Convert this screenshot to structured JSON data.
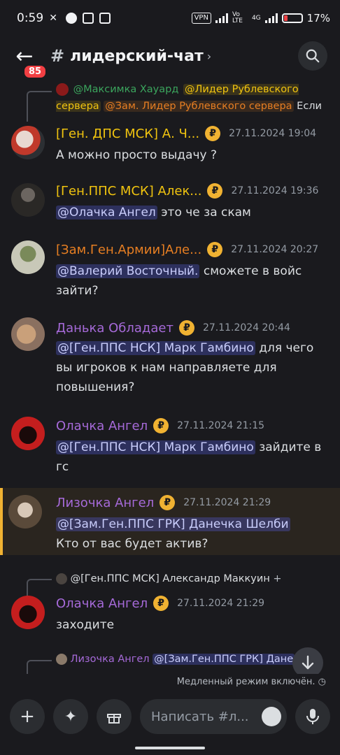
{
  "status_bar": {
    "time": "0:59",
    "vpn": "VPN",
    "volte": "Vo LTE",
    "network": "4G",
    "battery": "17%"
  },
  "header": {
    "unread_badge": "85",
    "channel_name": "лидерский-чат",
    "chevron": "›"
  },
  "reply_top": {
    "mention1": "@Максимка Хауард",
    "mention2": "@Лидер Рублевского сервера",
    "mention3": "@Зам. Лидер Рублевского сервера",
    "text": "Если"
  },
  "messages": [
    {
      "author": "[Ген. ДПС МСК] А. Ч...",
      "time": "27.11.2024 19:04",
      "body": "А можно просто выдачу ?"
    },
    {
      "author": "[Ген.ППС МСК] Алек...",
      "time": "27.11.2024 19:36",
      "mention": "@Олачка Ангел",
      "body": "это че за скам"
    },
    {
      "author": "[Зам.Ген.Армии]Але...",
      "time": "27.11.2024 20:27",
      "mention": "@Валерий Восточный.",
      "body": "сможете в войс зайти?"
    },
    {
      "author": "Данька Обладает",
      "time": "27.11.2024 20:44",
      "mention": "@[Ген.ППС НСК] Марк Гамбино",
      "body": "для чего вы игроков к нам направляете для повышения?"
    },
    {
      "author": "Олачка Ангел",
      "time": "27.11.2024 21:15",
      "mention": "@[Ген.ППС НСК] Марк Гамбино",
      "body": "зайдите  в гс"
    },
    {
      "author": "Лизочка Ангел",
      "time": "27.11.2024 21:29",
      "mention": "@[Зам.Ген.ППС ГРК] Данечка Шелби",
      "body": "Кто от вас будет актив?"
    },
    {
      "author": "Олачка Ангел",
      "time": "27.11.2024 21:29",
      "body": "заходите"
    }
  ],
  "reply_mid": {
    "mention": "@[Ген.ППС МСК] Александр Маккуин",
    "plus": "+"
  },
  "reply_bottom": {
    "author": "Лизочка Ангел",
    "mention": "@[Зам.Ген.ППС ГРК] Дане"
  },
  "slow_mode": "Медленный режим включён.",
  "composer": {
    "placeholder": "Написать #л..."
  },
  "currency_symbol": "₽",
  "colors": {
    "yellow": "#f1c40f",
    "orange": "#e67e22",
    "purple": "#a66ad9",
    "highlight": "#f0b232"
  }
}
